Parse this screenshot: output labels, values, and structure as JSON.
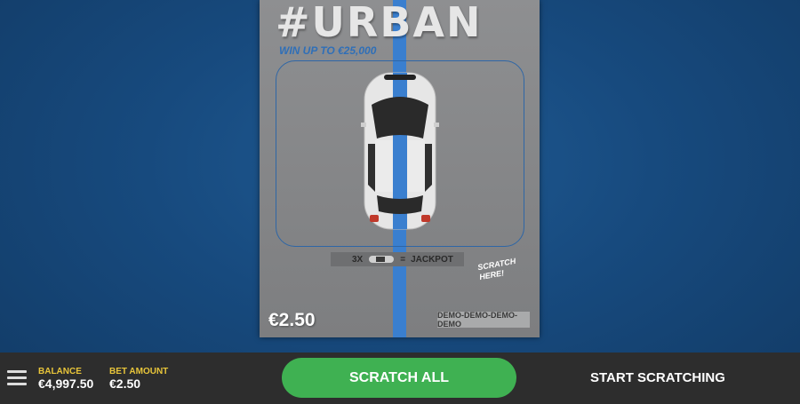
{
  "card": {
    "title": "#URBAN",
    "subtitle": "WIN UP TO €25,000",
    "jackpot_multiplier": "3X",
    "jackpot_label": "JACKPOT",
    "hint_text": "SCRATCH HERE!",
    "price": "€2.50",
    "demo_tag": "DEMO-DEMO-DEMO-DEMO",
    "stripe_color": "#3a7fcf",
    "car_color": "#e8e8e8"
  },
  "bottom_bar": {
    "balance_label": "BALANCE",
    "balance_value": "€4,997.50",
    "bet_label": "BET AMOUNT",
    "bet_value": "€2.50",
    "scratch_all_label": "SCRATCH ALL",
    "start_label": "START SCRATCHING",
    "accent_green": "#3fb152",
    "label_yellow": "#e8c53a"
  }
}
